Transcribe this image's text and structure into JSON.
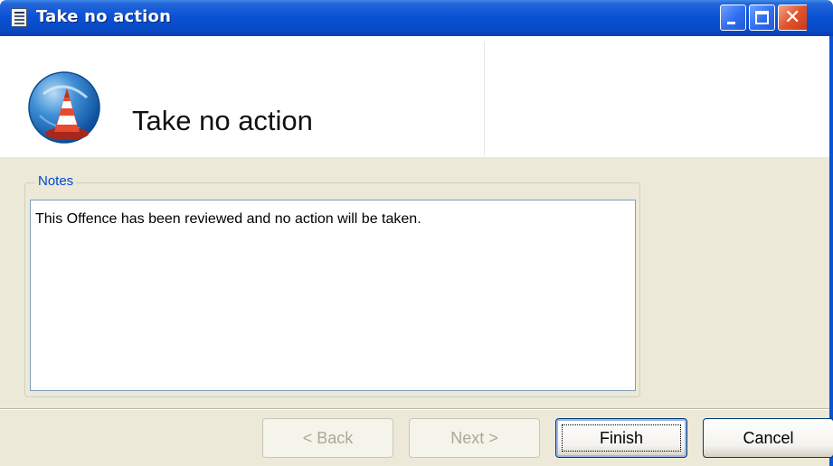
{
  "window": {
    "title": "Take no action"
  },
  "header": {
    "title": "Take no action",
    "icon": "traffic-cone-icon"
  },
  "notes": {
    "label": "Notes",
    "value": "This Offence has been reviewed and no action will be taken."
  },
  "footer": {
    "back_label": "< Back",
    "next_label": "Next >",
    "finish_label": "Finish",
    "cancel_label": "Cancel"
  },
  "colors": {
    "titlebar": "#0a52d6",
    "dialog_background": "#ece9d8",
    "notes_label": "#0046d5",
    "close_button": "#e2532d"
  }
}
